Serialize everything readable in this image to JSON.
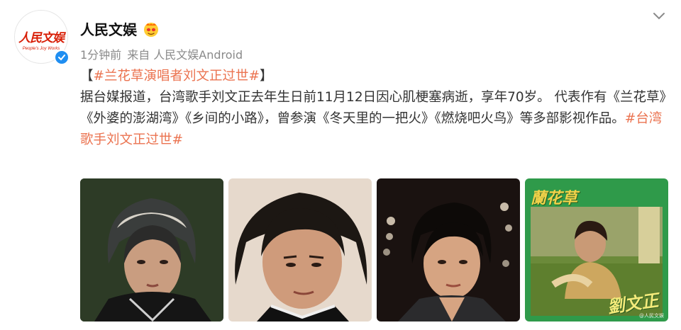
{
  "account": {
    "name": "人民文娱",
    "logo_text": "人民文娱",
    "logo_sub": "People's Joy Works",
    "verified": true
  },
  "meta": {
    "time": "1分钟前",
    "source": "来自 人民文娱Android"
  },
  "post": {
    "headline_open": "【",
    "headline_topic": "#兰花草演唱者刘文正过世#",
    "headline_close": "】",
    "body": "据台媒报道，台湾歌手刘文正去年生日前11月12日因心肌梗塞病逝，享年70岁。 代表作有《兰花草》《外婆的澎湖湾》《乡间的小路》，曾参演《冬天里的一把火》《燃烧吧火鸟》等多部影视作品。",
    "trailing_topic": "#台湾歌手刘文正过世#"
  },
  "images": [
    {
      "name": "photo-1"
    },
    {
      "name": "photo-2"
    },
    {
      "name": "photo-3"
    },
    {
      "name": "album-cover",
      "title": "蘭花草",
      "signature": "劉文正",
      "watermark": "@人民文娱"
    }
  ],
  "icons": {
    "chevron": "chevron-down-icon",
    "vip": "vip-emoji-icon",
    "verified": "verified-icon"
  },
  "colors": {
    "topic": "#eb7350",
    "verified": "#1f8ef1",
    "brand_red": "#d81e06"
  }
}
